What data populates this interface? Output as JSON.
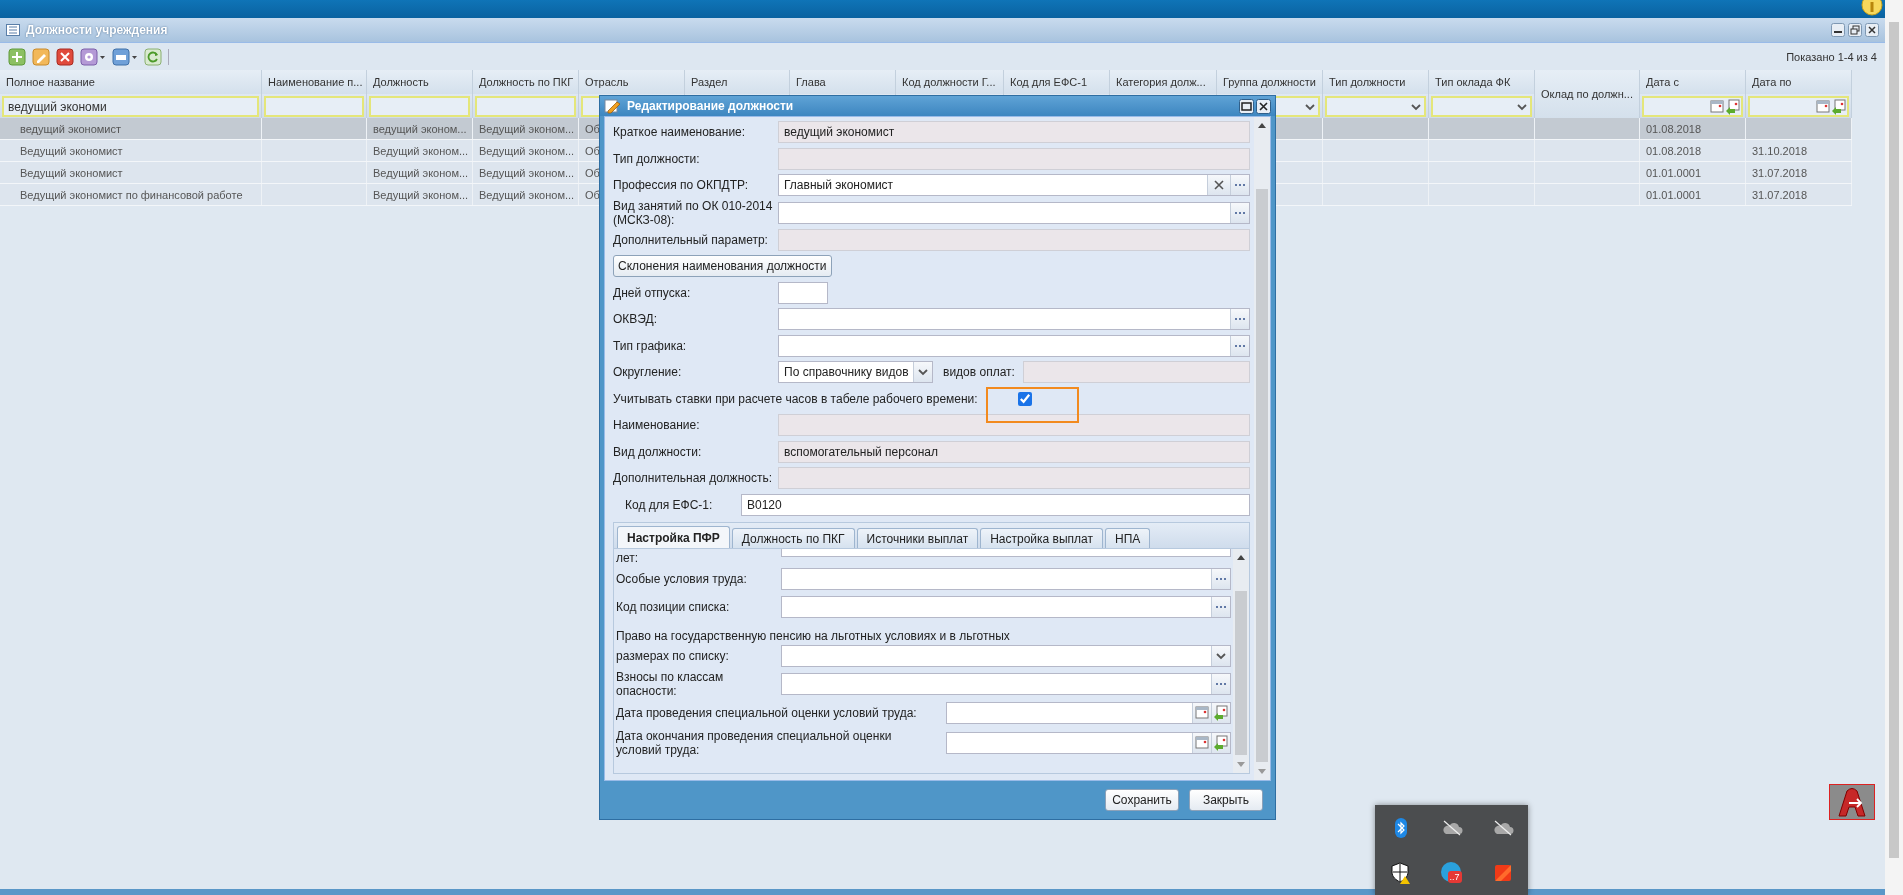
{
  "panel": {
    "title": "Должности учреждения",
    "status": "Показано 1-4 из 4"
  },
  "table": {
    "columns": [
      {
        "title": "Полное название",
        "kind": "text",
        "filter_value": "ведущий экономи"
      },
      {
        "title": "Наименование п...",
        "kind": "text"
      },
      {
        "title": "Должность",
        "kind": "text"
      },
      {
        "title": "Должность по ПКГ",
        "kind": "text"
      },
      {
        "title": "Отрасль",
        "kind": "text"
      },
      {
        "title": "Раздел",
        "kind": "none"
      },
      {
        "title": "Глава",
        "kind": "none"
      },
      {
        "title": "Код должности Г...",
        "kind": "none"
      },
      {
        "title": "Код для ЕФС-1",
        "kind": "none"
      },
      {
        "title": "Категория долж...",
        "kind": "none"
      },
      {
        "title": "Группа должности",
        "kind": "combo"
      },
      {
        "title": "Тип должности",
        "kind": "combo"
      },
      {
        "title": "Тип оклада ФК",
        "kind": "combo"
      },
      {
        "title": "Оклад по должн...",
        "kind": "none"
      },
      {
        "title": "Дата с",
        "kind": "date"
      },
      {
        "title": "Дата по",
        "kind": "date"
      }
    ],
    "rows": [
      {
        "selected": true,
        "full_name": "ведущий экономист",
        "position": "ведущий эконом...",
        "pkg_position": "Ведущий эконом...",
        "branch": "Об",
        "date_from": "01.08.2018"
      },
      {
        "selected": false,
        "full_name": "Ведущий экономист",
        "position": "Ведущий эконом...",
        "pkg_position": "Ведущий эконом...",
        "branch": "Об",
        "date_from": "01.08.2018",
        "date_to": "31.10.2018"
      },
      {
        "selected": false,
        "full_name": "Ведущий экономист",
        "position": "Ведущий эконом...",
        "pkg_position": "Ведущий эконом...",
        "branch": "Об",
        "date_from": "01.01.0001",
        "date_to": "31.07.2018"
      },
      {
        "selected": false,
        "full_name": "Ведущий экономист по финансовой работе",
        "position": "Ведущий эконом...",
        "pkg_position": "Ведущий эконом...",
        "branch": "Об",
        "date_from": "01.01.0001",
        "date_to": "31.07.2018"
      }
    ]
  },
  "dialog": {
    "title": "Редактирование должности",
    "fields": [
      {
        "kind": "field",
        "label": "Краткое наименование:",
        "value": "ведущий экономист",
        "readonly": true
      },
      {
        "kind": "field",
        "label": "Тип должности:",
        "readonly": true
      },
      {
        "kind": "field",
        "label": "Профессия по ОКПДТР:",
        "value": "Главный экономист",
        "readonly": false,
        "clearable": true,
        "lookup": true
      },
      {
        "kind": "field",
        "label": "Вид занятий по ОК 010-2014 (МСКЗ-08):",
        "readonly": false,
        "lookup": true
      },
      {
        "kind": "field",
        "label": "Дополнительный параметр:",
        "readonly": true
      },
      {
        "kind": "button",
        "label": "Склонения наименования должности"
      },
      {
        "kind": "short-field",
        "label": "Дней отпуска:",
        "readonly": false
      },
      {
        "kind": "field",
        "label": "ОКВЭД:",
        "readonly": false,
        "lookup": true
      },
      {
        "kind": "field",
        "label": "Тип графика:",
        "readonly": false,
        "lookup": true
      },
      {
        "kind": "combo",
        "label": "Округление:",
        "value": "По справочнику видов",
        "extra_label": "видов оплат:",
        "extra_readonly": true
      },
      {
        "kind": "checkbox",
        "label": "Учитывать ставки при расчете часов в табеле рабочего времени:",
        "checked": true
      },
      {
        "kind": "field",
        "label": "Наименование:",
        "readonly": true
      },
      {
        "kind": "field",
        "label": "Вид должности:",
        "value": "вспомогательный персонал",
        "readonly": true
      },
      {
        "kind": "field",
        "label": "Дополнительная должность:",
        "readonly": true
      },
      {
        "kind": "inset-field",
        "label": "Код для ЕФС-1:",
        "value": "В0120",
        "readonly": false
      }
    ],
    "tabs": [
      {
        "label": "Настройка ПФР",
        "selected": true
      },
      {
        "label": "Должность по ПКГ",
        "selected": false
      },
      {
        "label": "Источники выплат",
        "selected": false
      },
      {
        "label": "Настройка выплат",
        "selected": false
      },
      {
        "label": "НПА",
        "selected": false
      }
    ],
    "tab_fields": [
      {
        "kind": "cut-field",
        "label": "лет:"
      },
      {
        "kind": "field",
        "label": "Особые условия труда:",
        "readonly": false,
        "lookup": true
      },
      {
        "kind": "field",
        "label": "Код позиции списка:",
        "readonly": false,
        "lookup": true
      },
      {
        "kind": "note",
        "label": "Право на государственную пенсию на льготных условиях и в льготных"
      },
      {
        "kind": "combo-wide",
        "label": "размерах по списку:"
      },
      {
        "kind": "field",
        "label": "Взносы по классам опасности:",
        "readonly": false,
        "lookup": true
      },
      {
        "kind": "date",
        "label": "Дата проведения специальной оценки условий труда:"
      },
      {
        "kind": "date",
        "label": "Дата окончания проведения специальной оценки условий труда:"
      }
    ],
    "buttons": [
      "Сохранить",
      "Закрыть"
    ]
  },
  "tray": {
    "badge": "..7"
  }
}
